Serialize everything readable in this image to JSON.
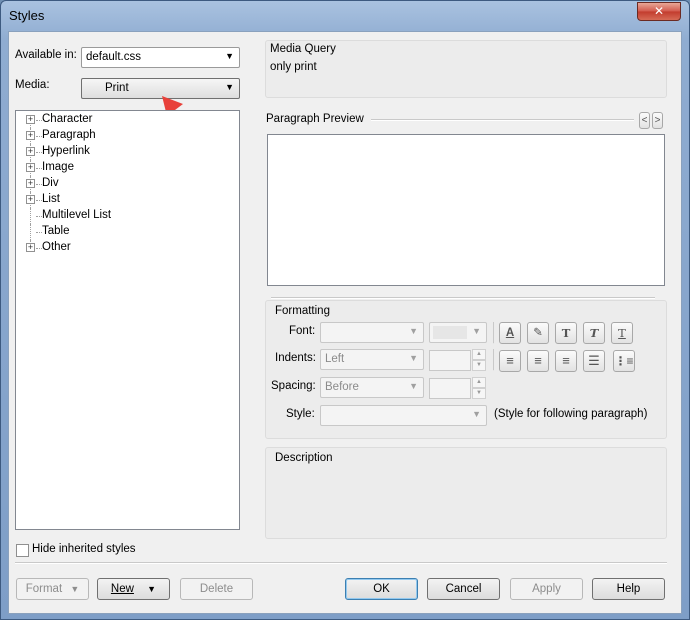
{
  "window": {
    "title": "Styles",
    "close_glyph": "✕"
  },
  "available_in": {
    "label": "Available in:",
    "value": "default.css"
  },
  "media": {
    "label": "Media:",
    "value": "Print"
  },
  "tree": {
    "items": [
      {
        "label": "Character",
        "expandable": true
      },
      {
        "label": "Paragraph",
        "expandable": true
      },
      {
        "label": "Hyperlink",
        "expandable": true
      },
      {
        "label": "Image",
        "expandable": true
      },
      {
        "label": "Div",
        "expandable": true
      },
      {
        "label": "List",
        "expandable": true
      },
      {
        "label": "Multilevel List",
        "expandable": false
      },
      {
        "label": "Table",
        "expandable": false
      },
      {
        "label": "Other",
        "expandable": true
      }
    ]
  },
  "media_query": {
    "title": "Media Query",
    "value": "only print"
  },
  "preview": {
    "title": "Paragraph Preview",
    "prev_glyph": "<",
    "next_glyph": ">"
  },
  "formatting": {
    "title": "Formatting",
    "font_label": "Font:",
    "indents_label": "Indents:",
    "indents_value": "Left",
    "spacing_label": "Spacing:",
    "spacing_value": "Before",
    "style_label": "Style:",
    "style_hint": "(Style for following paragraph)"
  },
  "description": {
    "title": "Description"
  },
  "hide_inherited": {
    "label": "Hide inherited styles",
    "checked": false
  },
  "buttons": {
    "format": "Format",
    "new": "New",
    "delete": "Delete",
    "ok": "OK",
    "cancel": "Cancel",
    "apply": "Apply",
    "help": "Help"
  },
  "annotation": {
    "arrow_color": "#e8413a"
  }
}
